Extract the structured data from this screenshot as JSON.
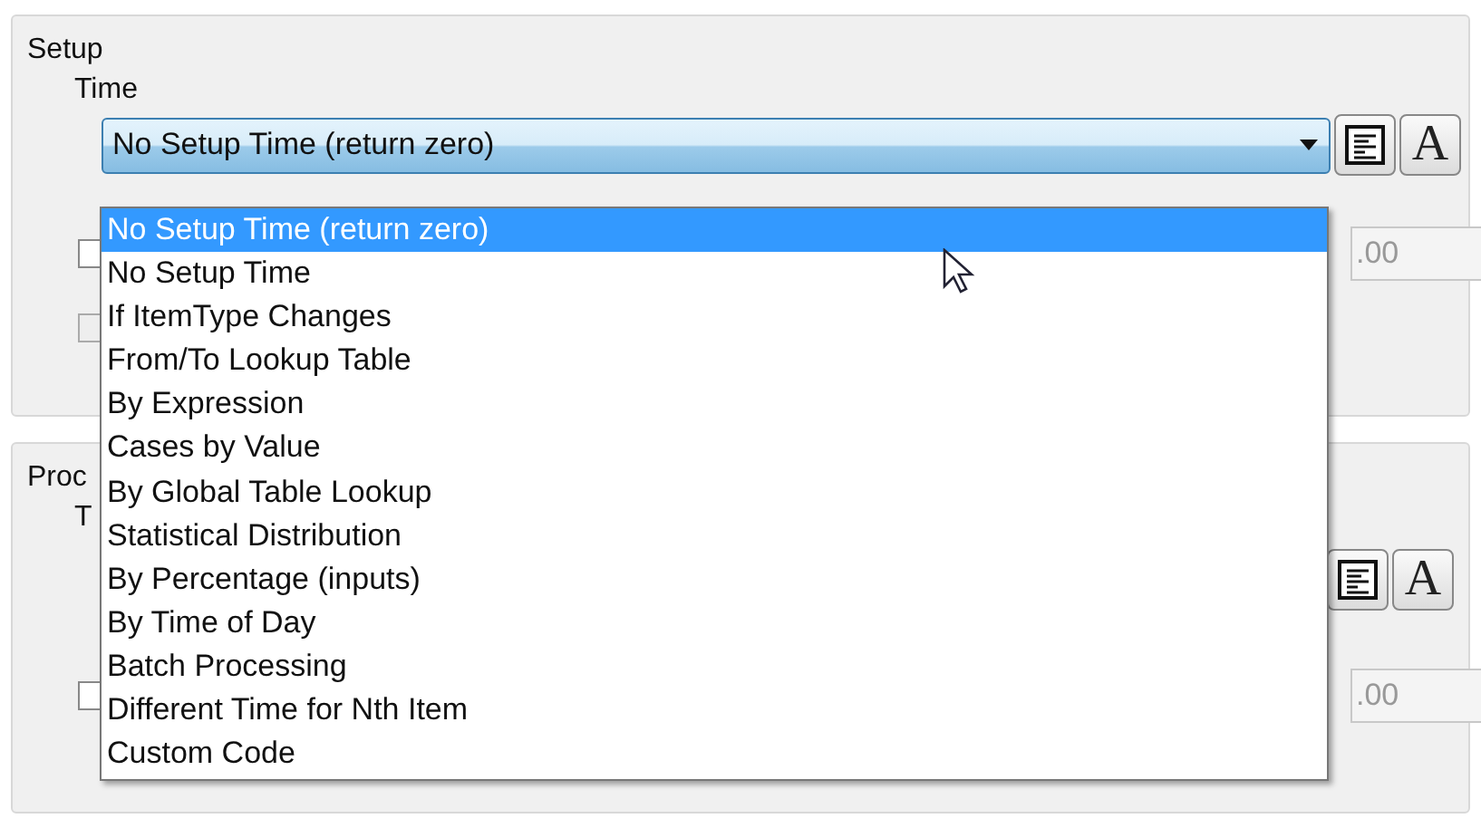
{
  "setup": {
    "title": "Setup",
    "time_label": "Time",
    "combo_value": "No Setup Time (return zero)",
    "field_value": ".00",
    "icon_buttons": [
      {
        "kind": "text",
        "label": "A"
      }
    ],
    "checkboxes": [
      {
        "checked": false,
        "disabled": false
      },
      {
        "checked": false,
        "disabled": true
      }
    ]
  },
  "process": {
    "title": "Proc",
    "time_label": "T",
    "field_value": ".00",
    "icon_buttons": [
      {
        "kind": "text",
        "label": "A"
      }
    ],
    "checkboxes": [
      {
        "checked": false,
        "disabled": false
      }
    ]
  },
  "dropdown": {
    "items": [
      {
        "label": "No Setup Time (return zero)",
        "selected": true
      },
      {
        "label": "No Setup Time",
        "selected": false
      },
      {
        "label": "If ItemType Changes",
        "selected": false
      },
      {
        "label": "From/To Lookup Table",
        "selected": false
      },
      {
        "label": "By Expression",
        "selected": false
      },
      {
        "label": "Cases by Value",
        "selected": false
      },
      {
        "label": "By Global Table Lookup",
        "selected": false
      },
      {
        "label": "Statistical Distribution",
        "selected": false
      },
      {
        "label": "By Percentage (inputs)",
        "selected": false
      },
      {
        "label": "By Time of Day",
        "selected": false
      },
      {
        "label": "Batch Processing",
        "selected": false
      },
      {
        "label": "Different Time for Nth Item",
        "selected": false
      },
      {
        "label": "Custom Code",
        "selected": false
      }
    ]
  }
}
